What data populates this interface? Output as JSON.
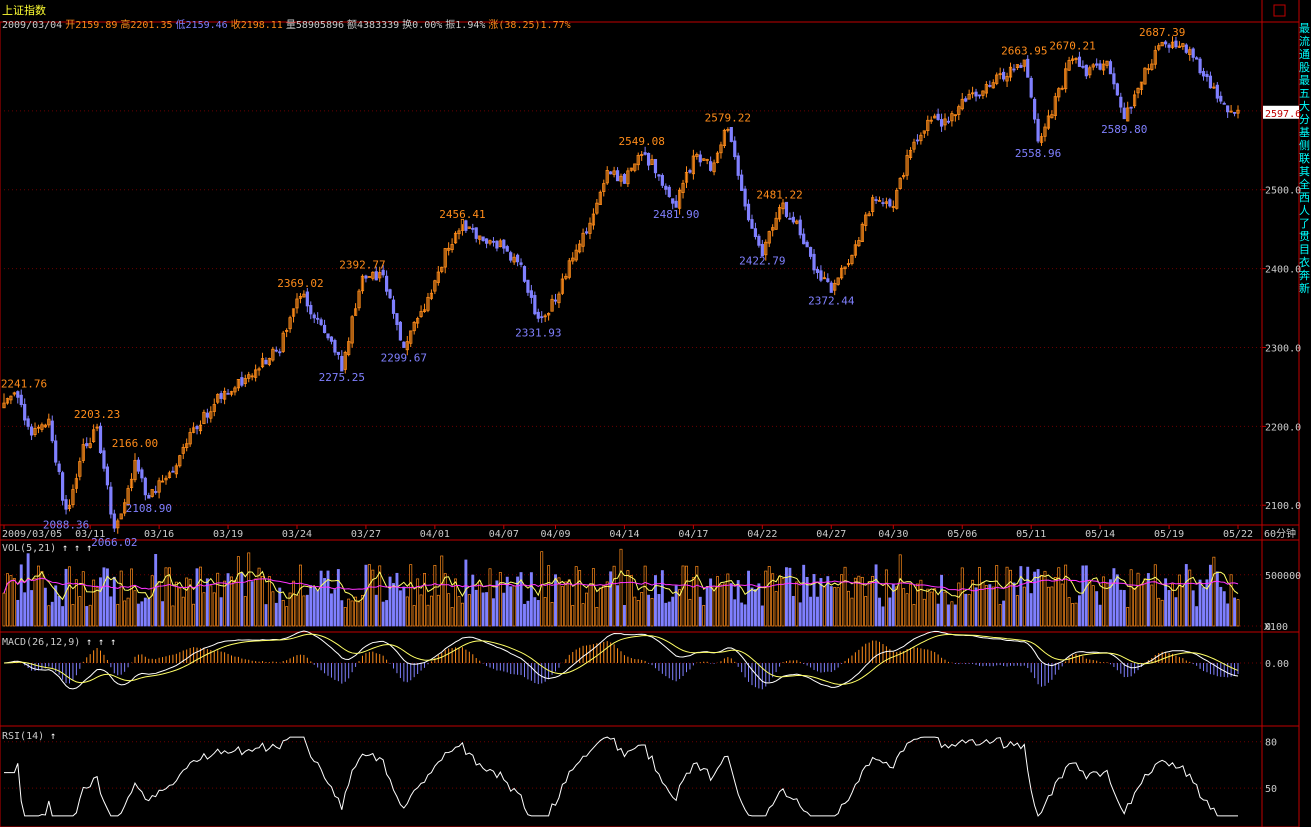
{
  "title": "上证指数",
  "quote": {
    "date": "2009/03/04",
    "open_label": "开",
    "open": "2159.89",
    "high_label": "高",
    "high": "2201.35",
    "low_label": "低",
    "low": "2159.46",
    "close_label": "收",
    "close": "2198.11",
    "volume_label": "量",
    "volume": "58905896",
    "amount_label": "额",
    "amount": "4383339",
    "turnover_label": "换",
    "turnover": "0.00%",
    "amplitude_label": "振",
    "amplitude": "1.94%",
    "change_label": "涨",
    "change": "(38.25)1.77%"
  },
  "period_label": "60分钟",
  "last_price_tag": "2597.6",
  "panels": {
    "vol": {
      "label": "VOL(5,21)",
      "unit_label": "X100"
    },
    "macd": {
      "label": "MACD(26,12,9)"
    },
    "rsi": {
      "label": "RSI(14)"
    }
  },
  "colors": {
    "up": "#ff8c1a",
    "down": "#8080ff",
    "axis": "#c00000",
    "grid": "#6a0000",
    "text": "#cccccc",
    "ma_yellow": "#ffff66",
    "ma_magenta": "#ff33ff"
  },
  "chart_data": [
    {
      "type": "candlestick",
      "name_cn": "上证指数",
      "y_ticks": [
        2100,
        2200,
        2300,
        2400,
        2500
      ],
      "ylim": [
        2080,
        2700
      ],
      "x_ticks": [
        {
          "i": 0,
          "label": "2009/03/05"
        },
        {
          "i": 25,
          "label": "03/11"
        },
        {
          "i": 45,
          "label": "03/16"
        },
        {
          "i": 65,
          "label": "03/19"
        },
        {
          "i": 85,
          "label": "03/24"
        },
        {
          "i": 105,
          "label": "03/27"
        },
        {
          "i": 125,
          "label": "04/01"
        },
        {
          "i": 145,
          "label": "04/07"
        },
        {
          "i": 160,
          "label": "04/09"
        },
        {
          "i": 180,
          "label": "04/14"
        },
        {
          "i": 200,
          "label": "04/17"
        },
        {
          "i": 220,
          "label": "04/22"
        },
        {
          "i": 240,
          "label": "04/27"
        },
        {
          "i": 258,
          "label": "04/30"
        },
        {
          "i": 278,
          "label": "05/06"
        },
        {
          "i": 298,
          "label": "05/11"
        },
        {
          "i": 318,
          "label": "05/14"
        },
        {
          "i": 338,
          "label": "05/19"
        },
        {
          "i": 358,
          "label": "05/22"
        }
      ],
      "control_points": [
        [
          0,
          2235
        ],
        [
          3,
          2242
        ],
        [
          8,
          2195
        ],
        [
          13,
          2210
        ],
        [
          18,
          2088
        ],
        [
          23,
          2170
        ],
        [
          27,
          2200
        ],
        [
          32,
          2066
        ],
        [
          38,
          2150
        ],
        [
          42,
          2109
        ],
        [
          48,
          2140
        ],
        [
          55,
          2195
        ],
        [
          62,
          2235
        ],
        [
          70,
          2260
        ],
        [
          80,
          2300
        ],
        [
          86,
          2369
        ],
        [
          92,
          2330
        ],
        [
          98,
          2275
        ],
        [
          104,
          2392
        ],
        [
          110,
          2390
        ],
        [
          116,
          2300
        ],
        [
          122,
          2350
        ],
        [
          128,
          2420
        ],
        [
          133,
          2456
        ],
        [
          138,
          2440
        ],
        [
          144,
          2430
        ],
        [
          150,
          2400
        ],
        [
          155,
          2332
        ],
        [
          160,
          2360
        ],
        [
          165,
          2420
        ],
        [
          170,
          2460
        ],
        [
          175,
          2520
        ],
        [
          180,
          2515
        ],
        [
          185,
          2549
        ],
        [
          190,
          2520
        ],
        [
          195,
          2482
        ],
        [
          200,
          2540
        ],
        [
          205,
          2530
        ],
        [
          210,
          2579
        ],
        [
          215,
          2480
        ],
        [
          220,
          2423
        ],
        [
          225,
          2481
        ],
        [
          230,
          2460
        ],
        [
          235,
          2400
        ],
        [
          240,
          2372
        ],
        [
          246,
          2420
        ],
        [
          252,
          2485
        ],
        [
          258,
          2480
        ],
        [
          262,
          2540
        ],
        [
          268,
          2590
        ],
        [
          273,
          2585
        ],
        [
          280,
          2620
        ],
        [
          285,
          2630
        ],
        [
          292,
          2650
        ],
        [
          296,
          2664
        ],
        [
          300,
          2559
        ],
        [
          304,
          2600
        ],
        [
          310,
          2670
        ],
        [
          314,
          2650
        ],
        [
          320,
          2660
        ],
        [
          325,
          2590
        ],
        [
          330,
          2640
        ],
        [
          336,
          2687
        ],
        [
          341,
          2685
        ],
        [
          345,
          2670
        ],
        [
          350,
          2630
        ],
        [
          355,
          2600
        ],
        [
          358,
          2597
        ]
      ],
      "annotations": [
        {
          "i": 0,
          "value": "2241.76",
          "kind": "high"
        },
        {
          "i": 18,
          "value": "2088.36",
          "kind": "low"
        },
        {
          "i": 27,
          "value": "2203.23",
          "kind": "high"
        },
        {
          "i": 32,
          "value": "2066.02",
          "kind": "low"
        },
        {
          "i": 38,
          "value": "2166.00",
          "kind": "high"
        },
        {
          "i": 42,
          "value": "2108.90",
          "kind": "low"
        },
        {
          "i": 86,
          "value": "2369.02",
          "kind": "high"
        },
        {
          "i": 98,
          "value": "2275.25",
          "kind": "low"
        },
        {
          "i": 104,
          "value": "2392.77",
          "kind": "high"
        },
        {
          "i": 116,
          "value": "2299.67",
          "kind": "low"
        },
        {
          "i": 133,
          "value": "2456.41",
          "kind": "high"
        },
        {
          "i": 155,
          "value": "2331.93",
          "kind": "low"
        },
        {
          "i": 185,
          "value": "2549.08",
          "kind": "high"
        },
        {
          "i": 195,
          "value": "2481.90",
          "kind": "low"
        },
        {
          "i": 210,
          "value": "2579.22",
          "kind": "high"
        },
        {
          "i": 220,
          "value": "2422.79",
          "kind": "low"
        },
        {
          "i": 225,
          "value": "2481.22",
          "kind": "high"
        },
        {
          "i": 240,
          "value": "2372.44",
          "kind": "low"
        },
        {
          "i": 296,
          "value": "2663.95",
          "kind": "high"
        },
        {
          "i": 300,
          "value": "2558.96",
          "kind": "low"
        },
        {
          "i": 310,
          "value": "2670.21",
          "kind": "high"
        },
        {
          "i": 325,
          "value": "2589.80",
          "kind": "low"
        },
        {
          "i": 336,
          "value": "2687.39",
          "kind": "high"
        }
      ],
      "bar_count": 359
    },
    {
      "type": "bar",
      "name": "VOL(5,21)",
      "y_ticks": [
        0,
        500000
      ],
      "ylim": [
        0,
        800000
      ]
    },
    {
      "type": "bar",
      "name": "MACD(26,12,9)",
      "y_ticks": [
        0.0
      ]
    },
    {
      "type": "line",
      "name": "RSI(14)",
      "y_ticks": [
        50,
        80
      ],
      "ylim": [
        30,
        85
      ]
    }
  ],
  "side_text": "最流通股最 五 大 分 基侧联其 全 西 人 了 贯 目 衣 奔 新"
}
